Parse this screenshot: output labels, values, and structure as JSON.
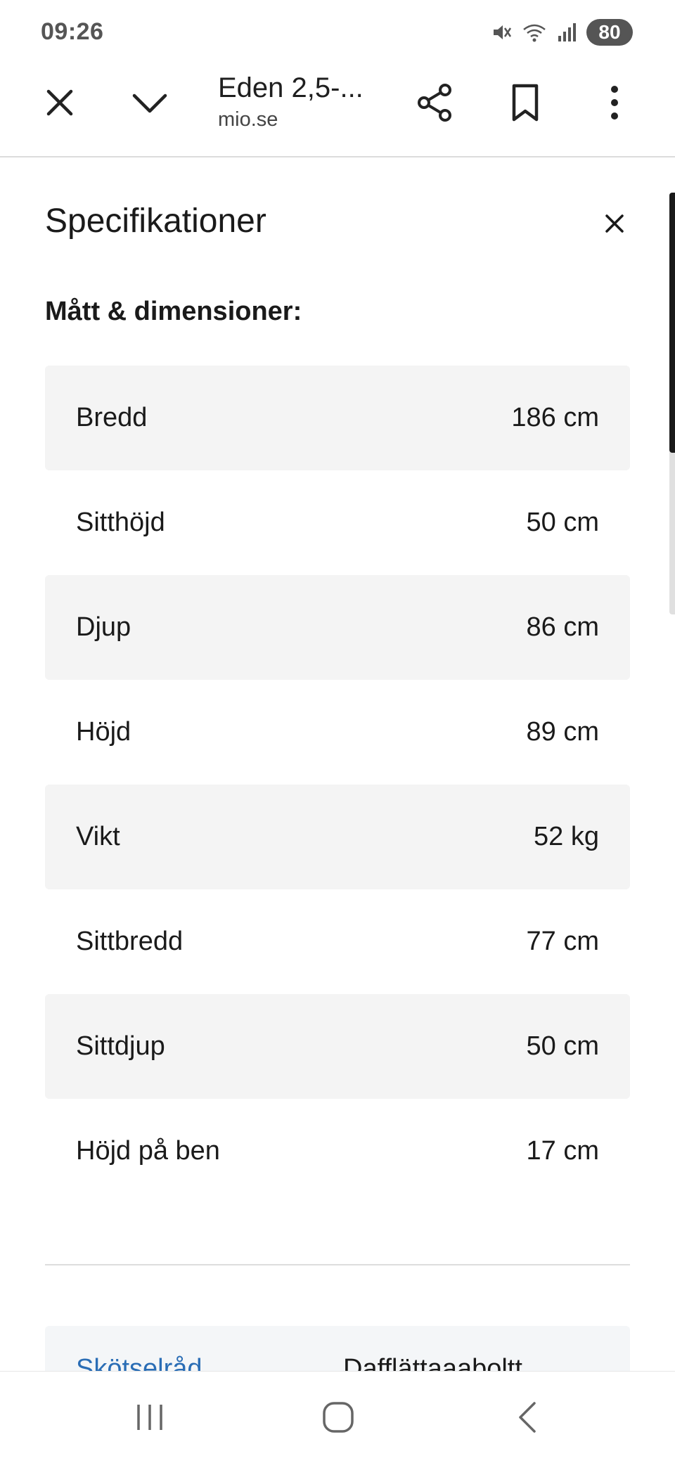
{
  "status_bar": {
    "time": "09:26",
    "battery_level": "80",
    "icons": [
      "mute-icon",
      "wifi-icon",
      "signal-icon",
      "battery-icon"
    ]
  },
  "toolbar": {
    "page_title": "Eden 2,5-...",
    "domain": "mio.se",
    "icons": [
      "close-icon",
      "chevron-down-icon",
      "share-icon",
      "bookmark-icon",
      "more-vertical-icon"
    ]
  },
  "sheet": {
    "title": "Specifikationer",
    "section_heading": "Mått & dimensioner:",
    "specs": [
      {
        "label": "Bredd",
        "value": "186 cm"
      },
      {
        "label": "Sitthöjd",
        "value": "50 cm"
      },
      {
        "label": "Djup",
        "value": "86 cm"
      },
      {
        "label": "Höjd",
        "value": "89 cm"
      },
      {
        "label": "Vikt",
        "value": "52 kg"
      },
      {
        "label": "Sittbredd",
        "value": "77 cm"
      },
      {
        "label": "Sittdjup",
        "value": "50 cm"
      },
      {
        "label": "Höjd på ben",
        "value": "17 cm"
      }
    ],
    "next_card": {
      "link": "Skötselråd",
      "value": "Dafflättaaaboltt..."
    }
  },
  "colors": {
    "row_shade": "#f4f4f4",
    "link": "#2a6db5",
    "text": "#1a1a1a"
  },
  "nav_bar": {
    "icons": [
      "recents-icon",
      "home-icon",
      "back-icon"
    ]
  }
}
